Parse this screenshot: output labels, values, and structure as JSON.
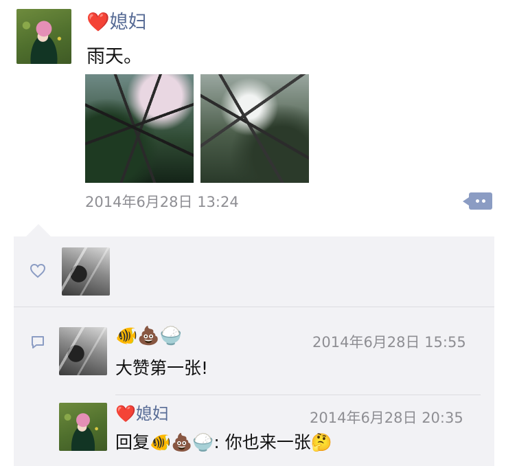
{
  "post": {
    "author": {
      "heart": "❤️",
      "name": "媳妇"
    },
    "text": "雨天。",
    "images": [
      "umbrella-photo",
      "trees-sky-photo"
    ],
    "timestamp": "2014年6月28日 13:24"
  },
  "likes": {
    "icon": "heart-outline-icon",
    "users": [
      "bw-photo-avatar"
    ]
  },
  "comments": [
    {
      "author": "🐠💩🍚",
      "time": "2014年6月28日 15:55",
      "text": "大赞第一张!"
    },
    {
      "author_heart": "❤️",
      "author_name": "媳妇",
      "time": "2014年6月28日 20:35",
      "reply_prefix": "回复",
      "reply_to": "🐠💩🍚",
      "text": ": 你也来一张",
      "trailing_emoji": "🤔"
    }
  ],
  "colors": {
    "name_blue": "#576b95",
    "panel_bg": "#f2f2f5",
    "meta_gray": "#8e8e93",
    "more_button": "#8b9cc3"
  }
}
